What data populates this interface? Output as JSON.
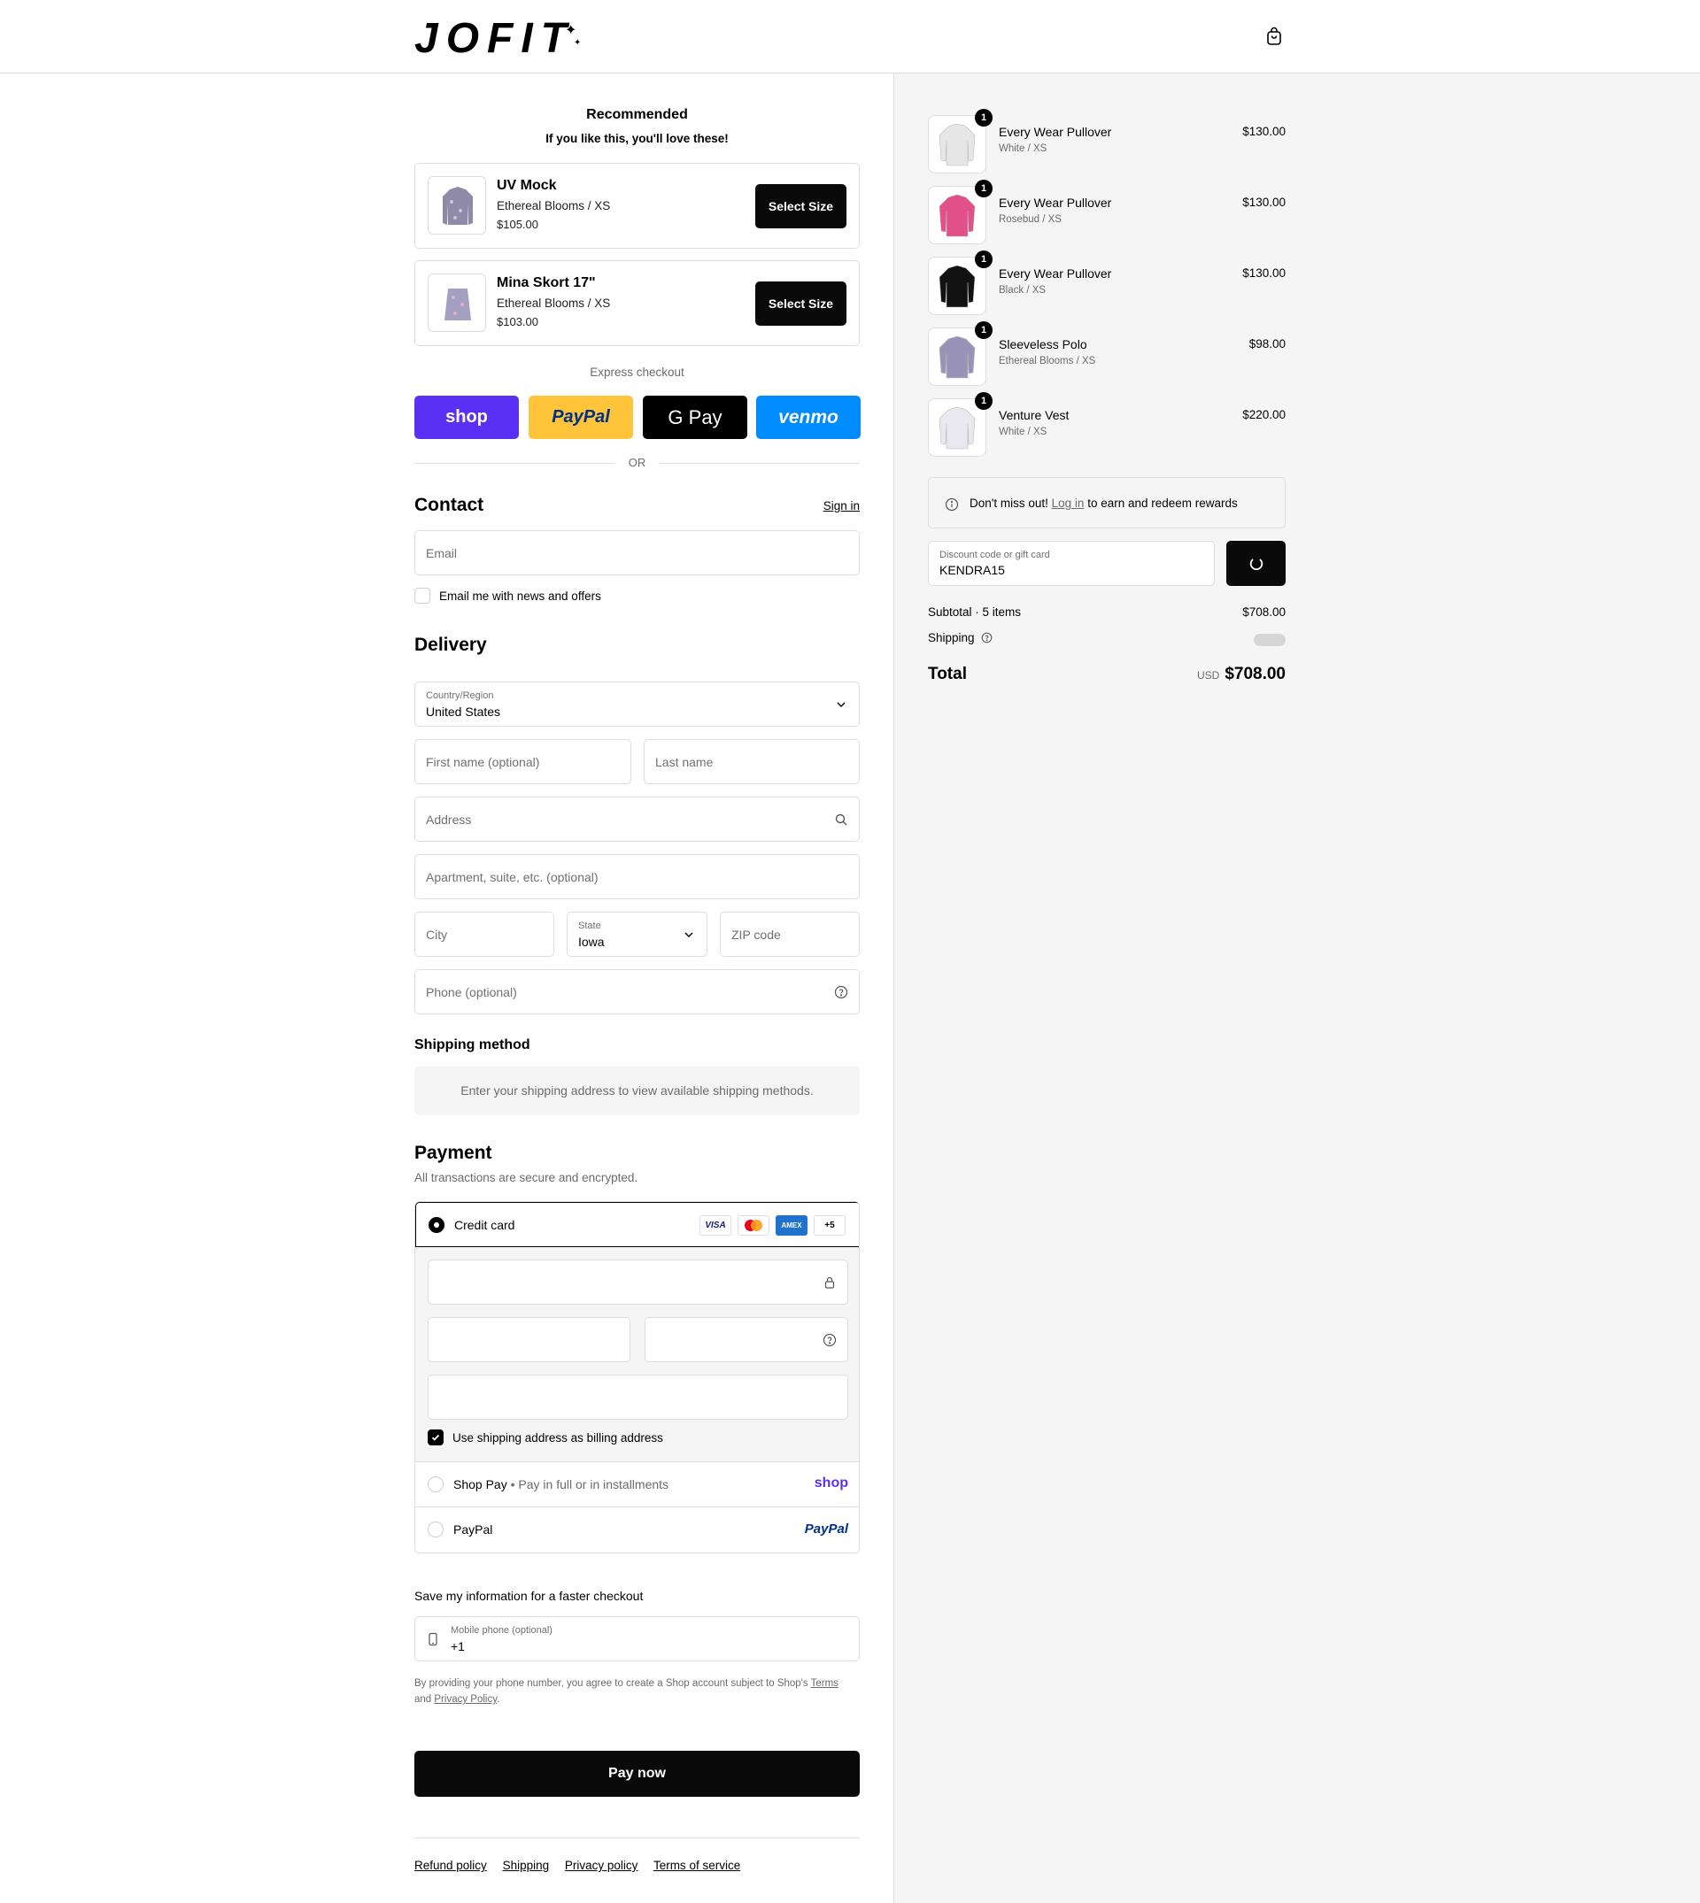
{
  "brand": {
    "logo_text": "JOFIT"
  },
  "recommended": {
    "title": "Recommended",
    "subtitle": "If you like this, you'll love these!",
    "items": [
      {
        "name": "UV Mock",
        "variant": "Ethereal Blooms / XS",
        "price": "$105.00",
        "button": "Select Size"
      },
      {
        "name": "Mina Skort 17\"",
        "variant": "Ethereal Blooms / XS",
        "price": "$103.00",
        "button": "Select Size"
      }
    ]
  },
  "express": {
    "label": "Express checkout",
    "buttons": [
      "shop",
      "PayPal",
      "G Pay",
      "venmo"
    ],
    "or": "OR"
  },
  "contact": {
    "heading": "Contact",
    "sign_in": "Sign in",
    "email_placeholder": "Email",
    "news_label": "Email me with news and offers"
  },
  "delivery": {
    "heading": "Delivery",
    "country_label": "Country/Region",
    "country_value": "United States",
    "first_name_placeholder": "First name (optional)",
    "last_name_placeholder": "Last name",
    "address_placeholder": "Address",
    "apartment_placeholder": "Apartment, suite, etc. (optional)",
    "city_placeholder": "City",
    "state_label": "State",
    "state_value": "Iowa",
    "zip_placeholder": "ZIP code",
    "phone_placeholder": "Phone (optional)"
  },
  "shipping_method": {
    "heading": "Shipping method",
    "note": "Enter your shipping address to view available shipping methods."
  },
  "payment": {
    "heading": "Payment",
    "subtitle": "All transactions are secure and encrypted.",
    "credit_card_label": "Credit card",
    "card_logos": [
      "VISA",
      "mastercard",
      "AMEX",
      "+5"
    ],
    "billing_label": "Use shipping address as billing address",
    "shop_pay_label": "Shop Pay",
    "shop_pay_sub": "Pay in full or in installments",
    "shop_pay_logo": "shop",
    "paypal_label": "PayPal",
    "paypal_logo": "PayPal"
  },
  "save_info": {
    "heading": "Save my information for a faster checkout",
    "phone_label": "Mobile phone (optional)",
    "phone_value": "+1",
    "legal_prefix": "By providing your phone number, you agree to create a Shop account subject to Shop's",
    "terms": "Terms",
    "and": "and",
    "privacy": "Privacy Policy",
    "period": "."
  },
  "pay_now": "Pay now",
  "footer": [
    "Refund policy",
    "Shipping",
    "Privacy policy",
    "Terms of service"
  ],
  "order": {
    "items": [
      {
        "qty": "1",
        "name": "Every Wear Pullover",
        "variant": "White / XS",
        "price": "$130.00",
        "color": "#e6e6e6"
      },
      {
        "qty": "1",
        "name": "Every Wear Pullover",
        "variant": "Rosebud / XS",
        "price": "$130.00",
        "color": "#e2508a"
      },
      {
        "qty": "1",
        "name": "Every Wear Pullover",
        "variant": "Black / XS",
        "price": "$130.00",
        "color": "#111111"
      },
      {
        "qty": "1",
        "name": "Sleeveless Polo",
        "variant": "Ethereal Blooms / XS",
        "price": "$98.00",
        "color": "#9a93b8"
      },
      {
        "qty": "1",
        "name": "Venture Vest",
        "variant": "White / XS",
        "price": "$220.00",
        "color": "#e8e8ee"
      }
    ],
    "rewards_prefix": "Don't miss out!",
    "rewards_link": "Log in",
    "rewards_suffix": "to earn and redeem rewards",
    "discount_label": "Discount code or gift card",
    "discount_value": "KENDRA15",
    "subtotal_label": "Subtotal · 5 items",
    "subtotal_value": "$708.00",
    "shipping_label": "Shipping",
    "total_label": "Total",
    "total_currency": "USD",
    "total_value": "$708.00"
  },
  "colors": {
    "accent": "#0a0a0a",
    "shop_purple": "#5a31f4",
    "paypal_yellow": "#ffc439",
    "venmo_blue": "#008cff",
    "sidebar_bg": "#f5f5f5"
  }
}
